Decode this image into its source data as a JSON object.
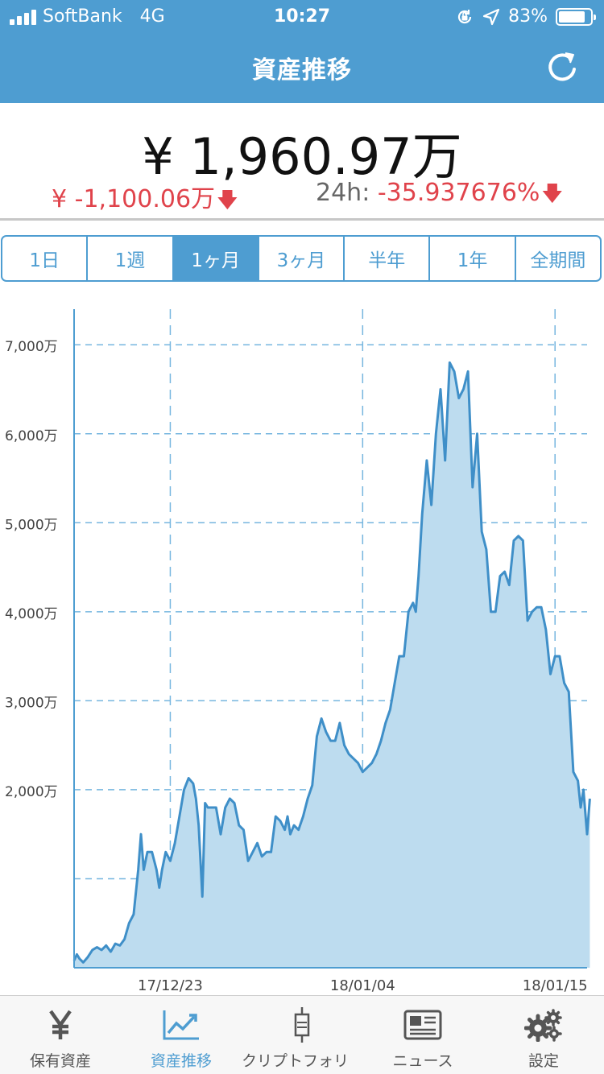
{
  "status_bar": {
    "carrier": "SoftBank",
    "network": "4G",
    "time": "10:27",
    "battery": "83%"
  },
  "header": {
    "title": "資産推移"
  },
  "summary": {
    "total": "¥ 1,960.97万",
    "change": "¥ -1,100.06万",
    "change_24h_label": "24h:",
    "change_24h_value": "-35.937676%"
  },
  "periods": [
    {
      "label": "1日",
      "active": false
    },
    {
      "label": "1週",
      "active": false
    },
    {
      "label": "1ヶ月",
      "active": true
    },
    {
      "label": "3ヶ月",
      "active": false
    },
    {
      "label": "半年",
      "active": false
    },
    {
      "label": "1年",
      "active": false
    },
    {
      "label": "全期間",
      "active": false
    }
  ],
  "chart_data": {
    "type": "area",
    "ylim": [
      0,
      7400
    ],
    "y_ticks": [
      2000,
      3000,
      4000,
      5000,
      6000,
      7000
    ],
    "y_tick_labels": [
      "2,000万",
      "3,000万",
      "4,000万",
      "5,000万",
      "6,000万",
      "7,000万"
    ],
    "x_ticks": [
      10.5,
      31.5,
      52.5
    ],
    "x_tick_labels": [
      "17/12/23",
      "18/01/04",
      "18/01/15"
    ],
    "x_max": 56,
    "y_unit": "万",
    "series": [
      {
        "values": [
          [
            0,
            80
          ],
          [
            0.3,
            150
          ],
          [
            0.6,
            100
          ],
          [
            1,
            60
          ],
          [
            1.5,
            120
          ],
          [
            2,
            200
          ],
          [
            2.5,
            230
          ],
          [
            3,
            200
          ],
          [
            3.5,
            250
          ],
          [
            4,
            180
          ],
          [
            4.5,
            270
          ],
          [
            5,
            250
          ],
          [
            5.5,
            320
          ],
          [
            6,
            500
          ],
          [
            6.5,
            600
          ],
          [
            7,
            1100
          ],
          [
            7.3,
            1500
          ],
          [
            7.6,
            1100
          ],
          [
            8,
            1300
          ],
          [
            8.5,
            1300
          ],
          [
            9,
            1100
          ],
          [
            9.3,
            900
          ],
          [
            9.6,
            1100
          ],
          [
            10,
            1300
          ],
          [
            10.5,
            1200
          ],
          [
            11,
            1400
          ],
          [
            11.5,
            1700
          ],
          [
            12,
            2000
          ],
          [
            12.5,
            2130
          ],
          [
            13,
            2070
          ],
          [
            13.3,
            1900
          ],
          [
            13.6,
            1600
          ],
          [
            14,
            800
          ],
          [
            14.3,
            1850
          ],
          [
            14.6,
            1800
          ],
          [
            15,
            1800
          ],
          [
            15.5,
            1800
          ],
          [
            16,
            1500
          ],
          [
            16.5,
            1800
          ],
          [
            17,
            1900
          ],
          [
            17.5,
            1850
          ],
          [
            18,
            1600
          ],
          [
            18.5,
            1550
          ],
          [
            19,
            1200
          ],
          [
            19.5,
            1300
          ],
          [
            20,
            1400
          ],
          [
            20.5,
            1250
          ],
          [
            21,
            1300
          ],
          [
            21.5,
            1300
          ],
          [
            22,
            1700
          ],
          [
            22.5,
            1650
          ],
          [
            23,
            1550
          ],
          [
            23.3,
            1700
          ],
          [
            23.6,
            1500
          ],
          [
            24,
            1600
          ],
          [
            24.5,
            1550
          ],
          [
            25,
            1700
          ],
          [
            25.5,
            1900
          ],
          [
            26,
            2050
          ],
          [
            26.5,
            2600
          ],
          [
            27,
            2800
          ],
          [
            27.5,
            2650
          ],
          [
            28,
            2550
          ],
          [
            28.5,
            2550
          ],
          [
            29,
            2750
          ],
          [
            29.5,
            2500
          ],
          [
            30,
            2400
          ],
          [
            30.5,
            2350
          ],
          [
            31,
            2300
          ],
          [
            31.5,
            2200
          ],
          [
            32,
            2250
          ],
          [
            32.5,
            2300
          ],
          [
            33,
            2400
          ],
          [
            33.5,
            2550
          ],
          [
            34,
            2750
          ],
          [
            34.5,
            2900
          ],
          [
            35,
            3200
          ],
          [
            35.5,
            3500
          ],
          [
            36,
            3500
          ],
          [
            36.5,
            4000
          ],
          [
            37,
            4100
          ],
          [
            37.3,
            4000
          ],
          [
            37.6,
            4400
          ],
          [
            38,
            5100
          ],
          [
            38.5,
            5700
          ],
          [
            39,
            5200
          ],
          [
            39.5,
            6000
          ],
          [
            40,
            6500
          ],
          [
            40.5,
            5700
          ],
          [
            41,
            6800
          ],
          [
            41.5,
            6700
          ],
          [
            42,
            6400
          ],
          [
            42.5,
            6500
          ],
          [
            43,
            6700
          ],
          [
            43.5,
            5400
          ],
          [
            44,
            6000
          ],
          [
            44.5,
            4900
          ],
          [
            45,
            4700
          ],
          [
            45.5,
            4000
          ],
          [
            46,
            4000
          ],
          [
            46.5,
            4400
          ],
          [
            47,
            4450
          ],
          [
            47.5,
            4300
          ],
          [
            48,
            4800
          ],
          [
            48.5,
            4850
          ],
          [
            49,
            4800
          ],
          [
            49.5,
            3900
          ],
          [
            50,
            4000
          ],
          [
            50.5,
            4050
          ],
          [
            51,
            4050
          ],
          [
            51.5,
            3800
          ],
          [
            52,
            3300
          ],
          [
            52.5,
            3500
          ],
          [
            53,
            3500
          ],
          [
            53.5,
            3200
          ],
          [
            54,
            3100
          ],
          [
            54.5,
            2200
          ],
          [
            55,
            2100
          ],
          [
            55.3,
            1800
          ],
          [
            55.6,
            2000
          ],
          [
            56,
            1500
          ],
          [
            56.3,
            1900
          ]
        ]
      }
    ],
    "colors": {
      "line": "#3f8fc8",
      "fill": "#bddcef",
      "grid": "#76b6df",
      "axis": "#4e9dd1"
    }
  },
  "tabs": [
    {
      "label": "保有資産",
      "icon": "yen-icon",
      "active": false
    },
    {
      "label": "資産推移",
      "icon": "chart-trend-icon",
      "active": true
    },
    {
      "label": "クリプトフォリオ",
      "icon": "candlestick-icon",
      "active": false
    },
    {
      "label": "ニュース",
      "icon": "newspaper-icon",
      "active": false
    },
    {
      "label": "設定",
      "icon": "gear-icon",
      "active": false
    }
  ]
}
